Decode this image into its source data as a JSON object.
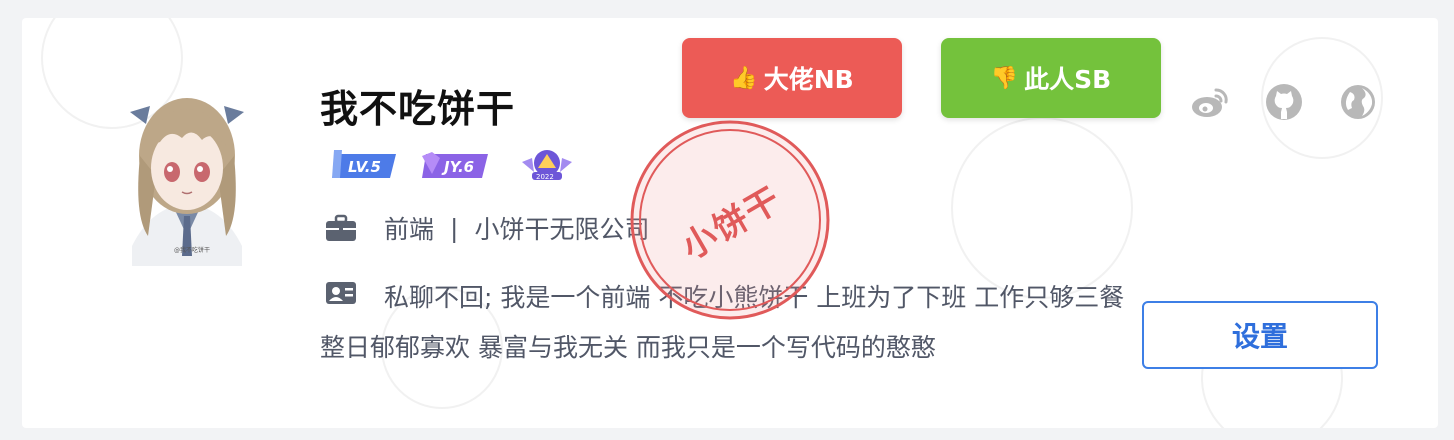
{
  "profile": {
    "name": "我不吃饼干",
    "job": {
      "title": "前端",
      "separator": "|",
      "company": "小饼干无限公司"
    },
    "bio": "私聊不回; 我是一个前端 不吃小熊饼干 上班为了下班 工作只够三餐 整日郁郁寡欢 暴富与我无关 而我只是一个写代码的憨憨",
    "badges": [
      {
        "name": "level-badge",
        "text": "LV.5"
      },
      {
        "name": "jy-badge",
        "text": "JY.6"
      },
      {
        "name": "year-badge",
        "text": "2022"
      }
    ],
    "avatar_signature": "@我不吃饼干"
  },
  "actions": {
    "like_label": "大佬NB",
    "dislike_label": "此人SB",
    "settings_label": "设置"
  },
  "social_icons": [
    "weibo-icon",
    "github-icon",
    "website-icon"
  ],
  "stamp": {
    "text": "小饼干"
  },
  "colors": {
    "like": "#ec5b56",
    "dislike": "#74c23c",
    "settings": "#3d7fe6",
    "stamp": "#e05a5a",
    "text_secondary": "#515767"
  }
}
